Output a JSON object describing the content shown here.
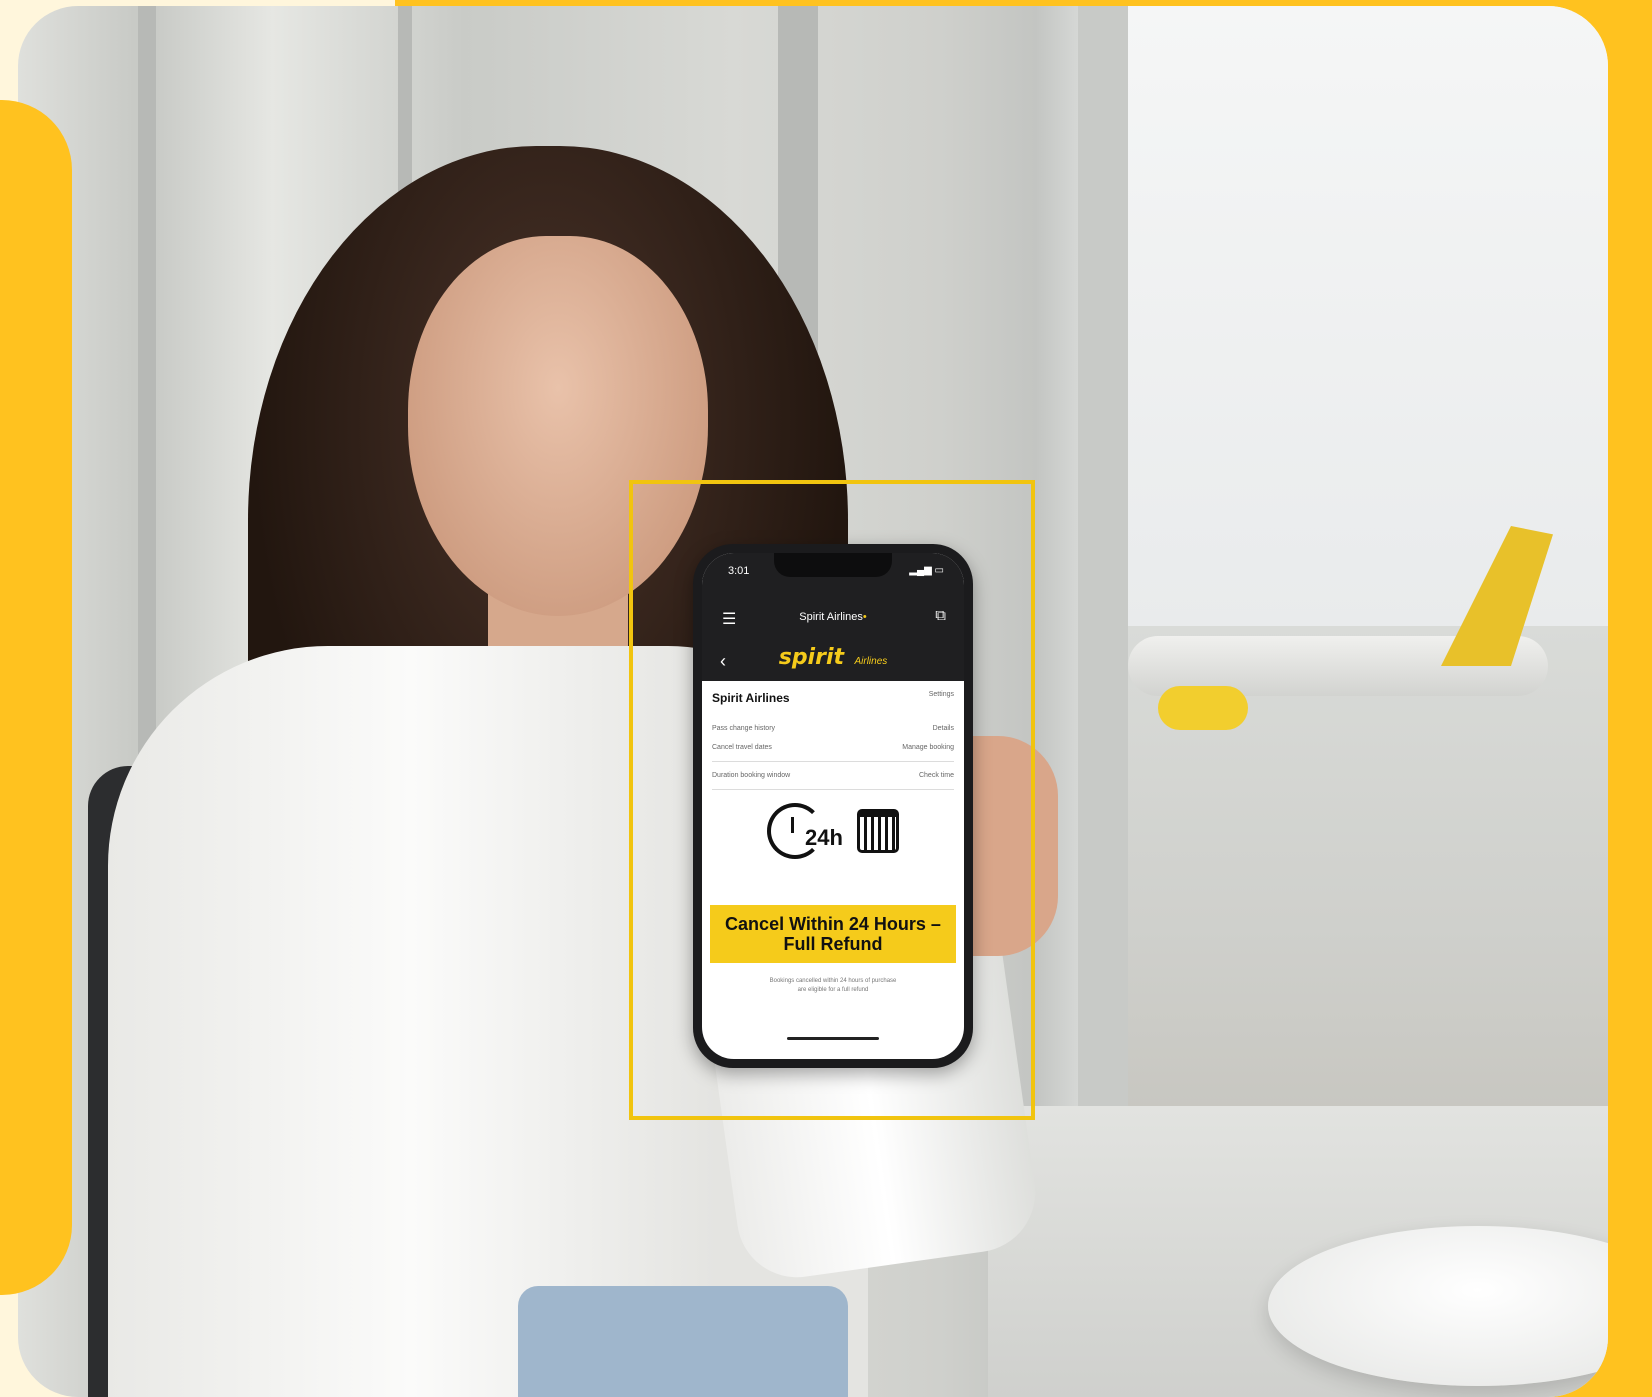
{
  "colors": {
    "accent_yellow": "#FFC21F",
    "brand_yellow": "#F5CB1B",
    "frame_yellow": "#F1C40F",
    "phone_dark": "#1f1f21"
  },
  "phone": {
    "status_time": "3:01",
    "app_title": "Spirit Airlines",
    "brand_logo": "spirit",
    "brand_sub": "Airlines",
    "list": {
      "header_left": "Spirit Airlines",
      "header_right": "Settings",
      "rows": [
        {
          "left": "Pass change history",
          "right": "Details"
        },
        {
          "left": "Cancel travel dates",
          "right": "Manage booking"
        },
        {
          "left": "Duration booking window",
          "right": "Check time"
        }
      ]
    },
    "icon_label": "24h",
    "cta_line1": "Cancel Within 24 Hours –",
    "cta_line2": "Full Refund",
    "fineprint_line1": "Bookings cancelled within 24 hours of purchase",
    "fineprint_line2": "are eligible for a full refund"
  },
  "icons": [
    "menu-icon",
    "share-icon",
    "back-icon",
    "clock-icon",
    "calendar-icon"
  ]
}
